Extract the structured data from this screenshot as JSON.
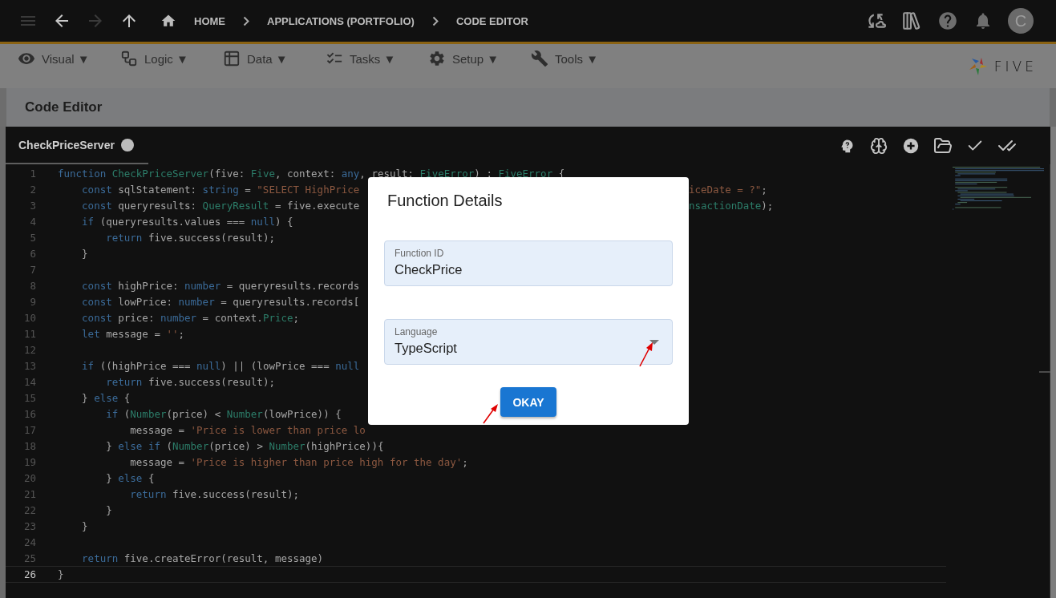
{
  "top_bar": {
    "nav": [
      {
        "kind": "menu",
        "disabled": true
      },
      {
        "kind": "back",
        "disabled": false
      },
      {
        "kind": "forward",
        "disabled": true
      },
      {
        "kind": "up",
        "disabled": false
      }
    ],
    "breadcrumbs": [
      {
        "kind": "home",
        "label": "HOME"
      },
      {
        "kind": "page",
        "label": "APPLICATIONS (PORTFOLIO)"
      },
      {
        "kind": "page",
        "label": "CODE EDITOR"
      }
    ],
    "avatar": "C"
  },
  "menu": [
    {
      "kind": "visual",
      "label": "Visual ▼"
    },
    {
      "kind": "logic",
      "label": "Logic ▼"
    },
    {
      "kind": "data",
      "label": "Data ▼"
    },
    {
      "kind": "tasks",
      "label": "Tasks ▼"
    },
    {
      "kind": "setup",
      "label": "Setup ▼"
    },
    {
      "kind": "tools",
      "label": "Tools ▼"
    }
  ],
  "logo": "FIVE",
  "page_title": "Code Editor",
  "editor": {
    "tab": {
      "title": "CheckPriceServer",
      "unsaved": true
    },
    "lines": [
      {
        "number": "1",
        "current": false,
        "code": [
          {
            "kind": "keyword",
            "text": "function "
          },
          {
            "kind": "type",
            "text": "CheckPriceServer"
          },
          {
            "kind": "plain",
            "text": "(five: "
          },
          {
            "kind": "type",
            "text": "Five"
          },
          {
            "kind": "plain",
            "text": ", context: "
          },
          {
            "kind": "keyword",
            "text": "any"
          },
          {
            "kind": "plain",
            "text": ", result: "
          },
          {
            "kind": "type",
            "text": "FiveError"
          },
          {
            "kind": "plain",
            "text": ") : "
          },
          {
            "kind": "type",
            "text": "FiveError"
          },
          {
            "kind": "plain",
            "text": " {"
          }
        ]
      },
      {
        "number": "2",
        "current": false,
        "code": [
          {
            "kind": "keyword",
            "text": "    const "
          },
          {
            "kind": "plain",
            "text": "sqlStatement: "
          },
          {
            "kind": "keyword",
            "text": "string"
          },
          {
            "kind": "plain",
            "text": " = "
          },
          {
            "kind": "string",
            "text": "\"SELECT HighPrice"
          }
        ],
        "right": [
          {
            "kind": "string",
            "text": "iceDate = ?\""
          },
          {
            "kind": "plain",
            "text": ";"
          }
        ]
      },
      {
        "number": "3",
        "current": false,
        "code": [
          {
            "kind": "keyword",
            "text": "    const "
          },
          {
            "kind": "plain",
            "text": "queryresults: "
          },
          {
            "kind": "type",
            "text": "QueryResult"
          },
          {
            "kind": "plain",
            "text": " = five.execute"
          }
        ],
        "right": [
          {
            "kind": "type",
            "text": "nsactionDate"
          },
          {
            "kind": "plain",
            "text": ");"
          }
        ]
      },
      {
        "number": "4",
        "current": false,
        "code": [
          {
            "kind": "keyword",
            "text": "    if "
          },
          {
            "kind": "plain",
            "text": "(queryresults.values === "
          },
          {
            "kind": "keyword",
            "text": "null"
          },
          {
            "kind": "plain",
            "text": ") {"
          }
        ]
      },
      {
        "number": "5",
        "current": false,
        "code": [
          {
            "kind": "keyword",
            "text": "        return "
          },
          {
            "kind": "plain",
            "text": "five.success(result);"
          }
        ]
      },
      {
        "number": "6",
        "current": false,
        "code": [
          {
            "kind": "plain",
            "text": "    }"
          }
        ]
      },
      {
        "number": "7",
        "current": false
      },
      {
        "number": "8",
        "current": false,
        "code": [
          {
            "kind": "keyword",
            "text": "    const "
          },
          {
            "kind": "plain",
            "text": "highPrice: "
          },
          {
            "kind": "keyword",
            "text": "number"
          },
          {
            "kind": "plain",
            "text": " = queryresults.records"
          }
        ]
      },
      {
        "number": "9",
        "current": false,
        "code": [
          {
            "kind": "keyword",
            "text": "    const "
          },
          {
            "kind": "plain",
            "text": "lowPrice: "
          },
          {
            "kind": "keyword",
            "text": "number"
          },
          {
            "kind": "plain",
            "text": " = queryresults.records["
          }
        ]
      },
      {
        "number": "10",
        "current": false,
        "code": [
          {
            "kind": "keyword",
            "text": "    const "
          },
          {
            "kind": "plain",
            "text": "price: "
          },
          {
            "kind": "keyword",
            "text": "number"
          },
          {
            "kind": "plain",
            "text": " = context."
          },
          {
            "kind": "type",
            "text": "Price"
          },
          {
            "kind": "plain",
            "text": ";"
          }
        ]
      },
      {
        "number": "11",
        "current": false,
        "code": [
          {
            "kind": "keyword",
            "text": "    let "
          },
          {
            "kind": "plain",
            "text": "message = "
          },
          {
            "kind": "string",
            "text": "''"
          },
          {
            "kind": "plain",
            "text": ";"
          }
        ]
      },
      {
        "number": "12",
        "current": false
      },
      {
        "number": "13",
        "current": false,
        "code": [
          {
            "kind": "keyword",
            "text": "    if "
          },
          {
            "kind": "plain",
            "text": "((highPrice === "
          },
          {
            "kind": "keyword",
            "text": "null"
          },
          {
            "kind": "plain",
            "text": ") || (lowPrice === "
          },
          {
            "kind": "keyword",
            "text": "null"
          }
        ]
      },
      {
        "number": "14",
        "current": false,
        "code": [
          {
            "kind": "keyword",
            "text": "        return "
          },
          {
            "kind": "plain",
            "text": "five.success(result);"
          }
        ]
      },
      {
        "number": "15",
        "current": false,
        "code": [
          {
            "kind": "plain",
            "text": "    } "
          },
          {
            "kind": "keyword",
            "text": "else"
          },
          {
            "kind": "plain",
            "text": " {"
          }
        ]
      },
      {
        "number": "16",
        "current": false,
        "code": [
          {
            "kind": "keyword",
            "text": "        if "
          },
          {
            "kind": "plain",
            "text": "("
          },
          {
            "kind": "type",
            "text": "Number"
          },
          {
            "kind": "plain",
            "text": "(price) < "
          },
          {
            "kind": "type",
            "text": "Number"
          },
          {
            "kind": "plain",
            "text": "(lowPrice)) {"
          }
        ]
      },
      {
        "number": "17",
        "current": false,
        "code": [
          {
            "kind": "plain",
            "text": "            message = "
          },
          {
            "kind": "string",
            "text": "'Price is lower than price lo"
          }
        ]
      },
      {
        "number": "18",
        "current": false,
        "code": [
          {
            "kind": "plain",
            "text": "        } "
          },
          {
            "kind": "keyword",
            "text": "else if "
          },
          {
            "kind": "plain",
            "text": "("
          },
          {
            "kind": "type",
            "text": "Number"
          },
          {
            "kind": "plain",
            "text": "(price) > "
          },
          {
            "kind": "type",
            "text": "Number"
          },
          {
            "kind": "plain",
            "text": "(highPrice)){"
          }
        ]
      },
      {
        "number": "19",
        "current": false,
        "code": [
          {
            "kind": "plain",
            "text": "            message = "
          },
          {
            "kind": "string",
            "text": "'Price is higher than price high for the day'"
          },
          {
            "kind": "plain",
            "text": ";"
          }
        ]
      },
      {
        "number": "20",
        "current": false,
        "code": [
          {
            "kind": "plain",
            "text": "        } "
          },
          {
            "kind": "keyword",
            "text": "else"
          },
          {
            "kind": "plain",
            "text": " {"
          }
        ]
      },
      {
        "number": "21",
        "current": false,
        "code": [
          {
            "kind": "keyword",
            "text": "            return "
          },
          {
            "kind": "plain",
            "text": "five.success(result);"
          }
        ]
      },
      {
        "number": "22",
        "current": false,
        "code": [
          {
            "kind": "plain",
            "text": "        }"
          }
        ]
      },
      {
        "number": "23",
        "current": false,
        "code": [
          {
            "kind": "plain",
            "text": "    }"
          }
        ]
      },
      {
        "number": "24",
        "current": false
      },
      {
        "number": "25",
        "current": false,
        "code": [
          {
            "kind": "keyword",
            "text": "    return "
          },
          {
            "kind": "plain",
            "text": "five.createError(result, message)"
          }
        ]
      },
      {
        "number": "26",
        "current": true,
        "code": [
          {
            "kind": "plain",
            "text": "}"
          }
        ]
      }
    ]
  },
  "dialog": {
    "title": "Function Details",
    "fields": [
      {
        "kind": "text",
        "label": "Function ID",
        "value": "CheckPrice"
      },
      {
        "kind": "select",
        "label": "Language",
        "value": "TypeScript"
      }
    ],
    "button": "OKAY"
  }
}
